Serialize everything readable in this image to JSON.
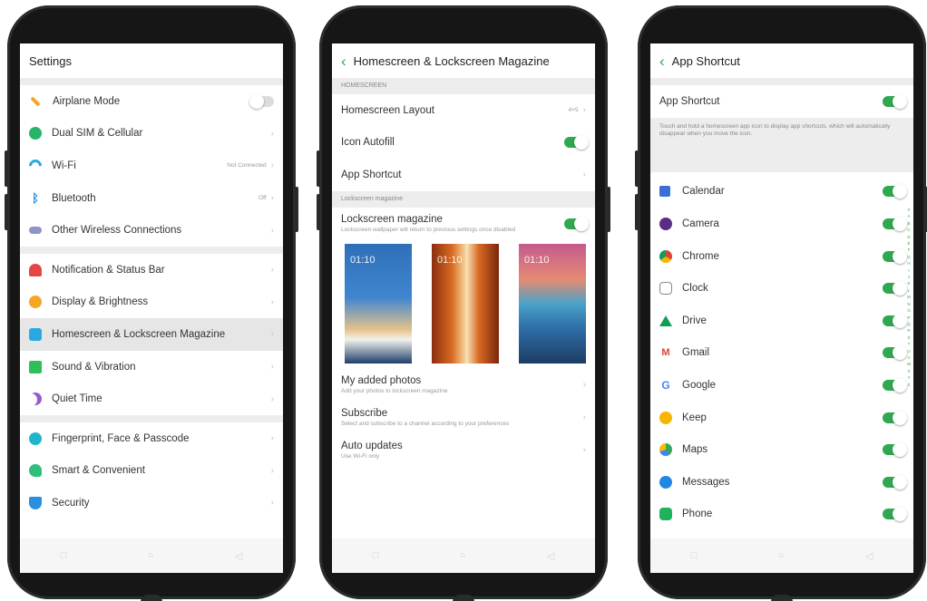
{
  "phones": {
    "settings": {
      "title": "Settings",
      "airplane_label": "Airplane Mode",
      "dualsim_label": "Dual SIM & Cellular",
      "wifi_label": "Wi-Fi",
      "wifi_value": "Not Connected",
      "bluetooth_label": "Bluetooth",
      "bluetooth_value": "Off",
      "wireless_label": "Other Wireless Connections",
      "notification_label": "Notification & Status Bar",
      "display_label": "Display & Brightness",
      "homescreen_label": "Homescreen & Lockscreen Magazine",
      "sound_label": "Sound & Vibration",
      "quiet_label": "Quiet Time",
      "fingerprint_label": "Fingerprint, Face & Passcode",
      "smart_label": "Smart & Convenient",
      "security_label": "Security"
    },
    "magazine": {
      "title": "Homescreen & Lockscreen Magazine",
      "section_homescreen": "HOMESCREEN",
      "layout_label": "Homescreen Layout",
      "layout_value": "4×5",
      "autofill_label": "Icon Autofill",
      "shortcut_label": "App Shortcut",
      "section_lockscreen": "Lockscreen magazine",
      "lockscreen_title": "Lockscreen magazine",
      "lockscreen_sub": "Lockscreen wallpaper will return to previous settings once disabled",
      "thumb_time": "01:10",
      "added_title": "My added photos",
      "added_sub": "Add your photos to lockscreen magazine",
      "subscribe_title": "Subscribe",
      "subscribe_sub": "Select and subscribe to a channel according to your preferences",
      "updates_title": "Auto updates",
      "updates_sub": "Use Wi-Fi only"
    },
    "shortcut": {
      "title": "App Shortcut",
      "toggle_label": "App Shortcut",
      "description": "Touch and hold a homescreen app icon to display app shortcuts, which will automatically disappear when you move the icon.",
      "apps": [
        "Calendar",
        "Camera",
        "Chrome",
        "Clock",
        "Drive",
        "Gmail",
        "Google",
        "Keep",
        "Maps",
        "Messages",
        "Phone"
      ],
      "alphabet": [
        "#",
        "A",
        "B",
        "C",
        "D",
        "E",
        "F",
        "G",
        "H",
        "I",
        "J",
        "K",
        "L",
        "M",
        "N",
        "O",
        "P",
        "Q",
        "R",
        "S",
        "T",
        "U",
        "V",
        "W",
        "X",
        "Y",
        "Z"
      ]
    },
    "nav_icons": [
      "square-icon",
      "circle-icon",
      "triangle-icon"
    ]
  },
  "toggles": {
    "airplane": false,
    "autofill": true,
    "lockscreen": true,
    "app_shortcut": true,
    "apps_all_on": true
  },
  "colors": {
    "accent": "#2fa84f",
    "section_bg": "#ededed",
    "selected_row": "#e6e6e6",
    "phone_body": "#161616"
  }
}
